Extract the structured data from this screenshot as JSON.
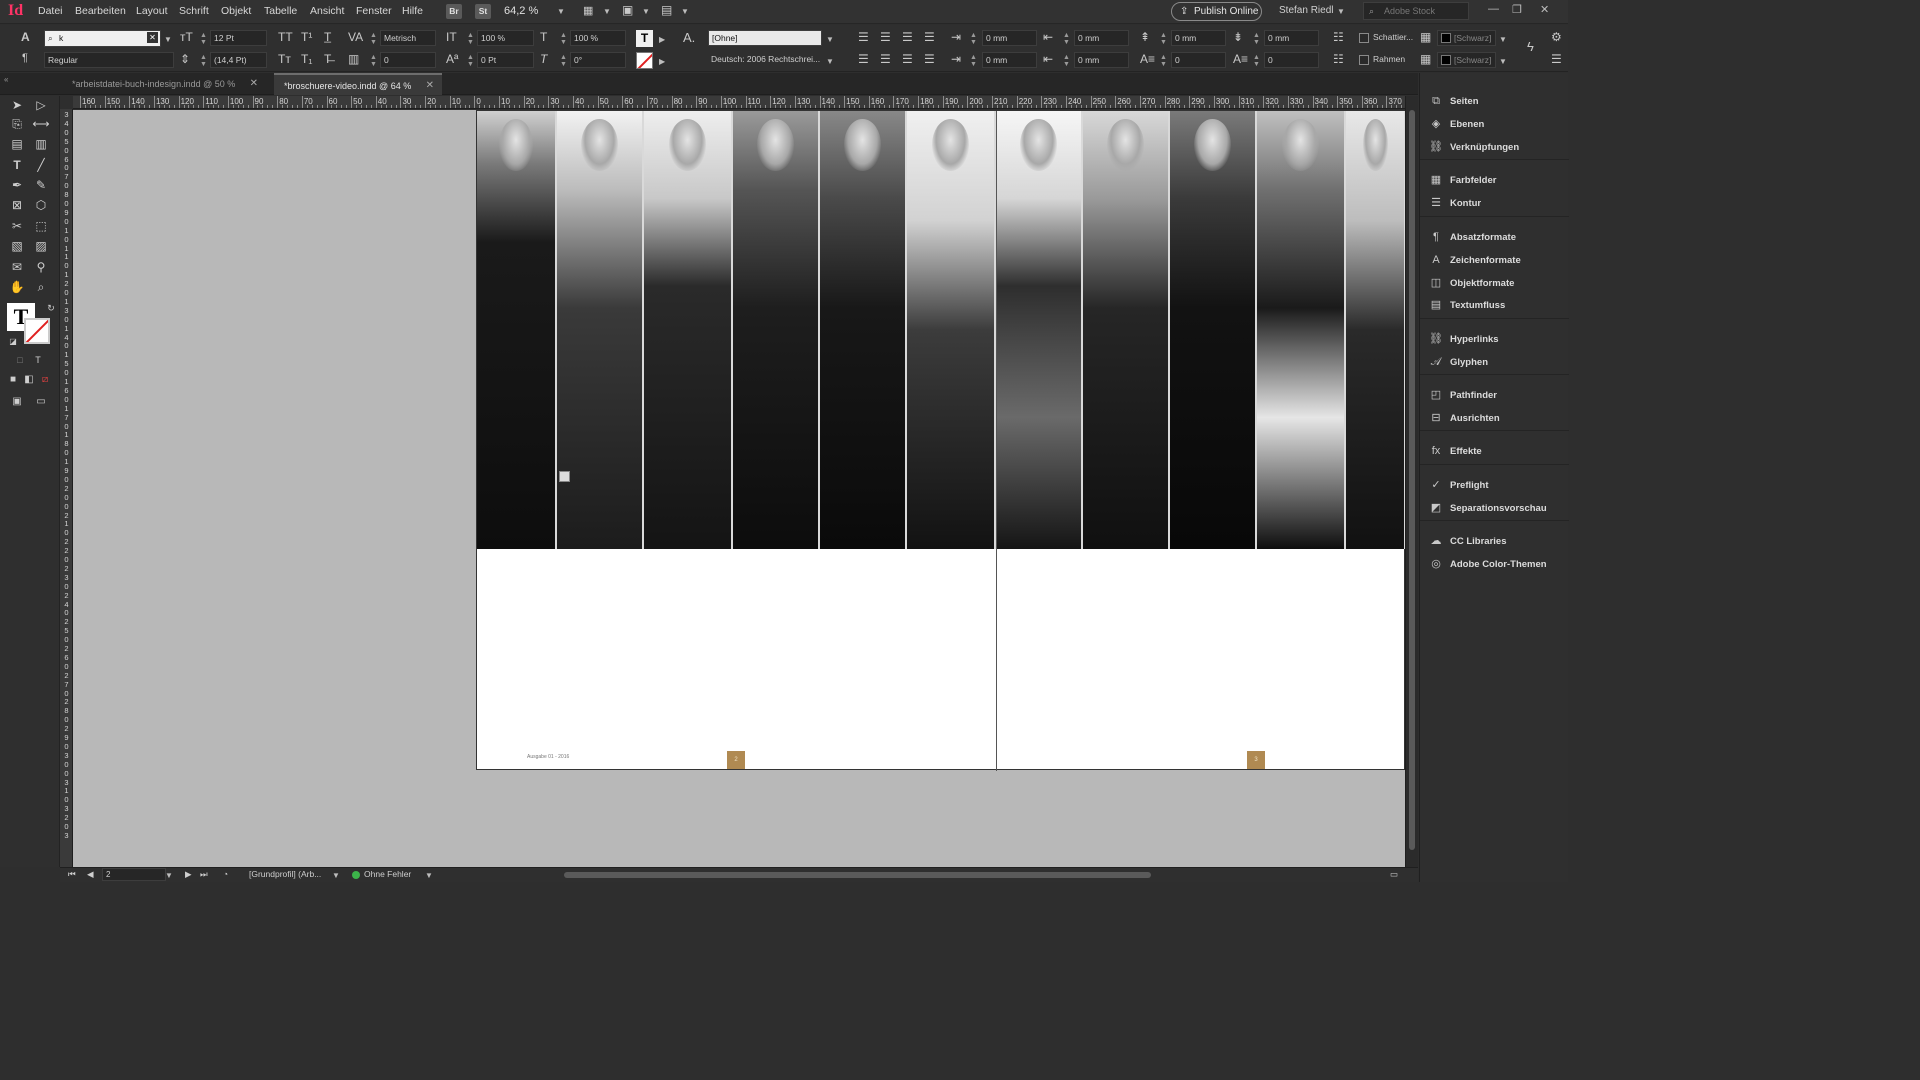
{
  "app": {
    "logo": "Id"
  },
  "menu": [
    "Datei",
    "Bearbeiten",
    "Layout",
    "Schrift",
    "Objekt",
    "Tabelle",
    "Ansicht",
    "Fenster",
    "Hilfe"
  ],
  "app_bar": {
    "bridge": "Br",
    "stock": "St",
    "zoom": "64,2 %",
    "publish": "Publish Online",
    "user": "Stefan Riedl",
    "stock_search_placeholder": "Adobe Stock"
  },
  "control": {
    "font_search_value": "k",
    "font_style": "Regular",
    "font_size": "12 Pt",
    "leading": "(14,4 Pt)",
    "kerning": "Metrisch",
    "tracking": "0",
    "vertical_scale": "100 %",
    "horizontal_scale": "100 %",
    "baseline_shift": "0 Pt",
    "skew": "0°",
    "char_style": "[Ohne]",
    "language": "Deutsch: 2006 Rechtschrei...",
    "left_indent": "0 mm",
    "first_line_indent": "0 mm",
    "right_indent": "0 mm",
    "last_line_indent": "0 mm",
    "space_before": "0 mm",
    "space_after": "0 mm",
    "drop_cap_lines": "0",
    "drop_cap_chars": "0",
    "shading_label": "Schattier...",
    "frame_label": "Rahmen",
    "shading_swatch": "[Schwarz]",
    "frame_swatch": "[Schwarz]"
  },
  "tabs": [
    {
      "label": "*arbeistdatei-buch-indesign.indd @ 50 %",
      "active": false
    },
    {
      "label": "*broschuere-video.indd @ 64 %",
      "active": true
    }
  ],
  "ruler_h": [
    "160",
    "150",
    "140",
    "130",
    "120",
    "110",
    "100",
    "90",
    "80",
    "70",
    "60",
    "50",
    "40",
    "30",
    "20",
    "10",
    "0",
    "10",
    "20",
    "30",
    "40",
    "50",
    "60",
    "70",
    "80",
    "90",
    "100",
    "110",
    "120",
    "130",
    "140",
    "150",
    "160",
    "170",
    "180",
    "190",
    "200",
    "210",
    "220",
    "230",
    "240",
    "250",
    "260",
    "270",
    "280",
    "290",
    "300",
    "310",
    "320",
    "330",
    "340",
    "350",
    "360",
    "370"
  ],
  "ruler_v": [
    "3",
    "4",
    "0",
    "5",
    "0",
    "6",
    "0",
    "7",
    "0",
    "8",
    "0",
    "9",
    "0",
    "1",
    "0",
    "1",
    "1",
    "0",
    "1",
    "2",
    "0",
    "1",
    "3",
    "0",
    "1",
    "4",
    "0",
    "1",
    "5",
    "0",
    "1",
    "6",
    "0",
    "1",
    "7",
    "0",
    "1",
    "8",
    "0",
    "1",
    "9",
    "0",
    "2",
    "0",
    "0",
    "2",
    "1",
    "0",
    "2",
    "2",
    "0",
    "2",
    "3",
    "0",
    "2",
    "4",
    "0",
    "2",
    "5",
    "0",
    "2",
    "6",
    "0",
    "2",
    "7",
    "0",
    "2",
    "8",
    "0",
    "2",
    "9",
    "0",
    "3",
    "0",
    "0",
    "3",
    "1",
    "0",
    "3",
    "2",
    "0",
    "3"
  ],
  "document": {
    "footer_text": "Ausgabe 01 - 2016",
    "page_left": "2",
    "page_right": "3"
  },
  "status": {
    "page": "2",
    "profile": "[Grundprofil] (Arb...",
    "preflight": "Ohne Fehler"
  },
  "panels": [
    {
      "label": "Seiten",
      "icon": "pages-icon"
    },
    {
      "label": "Ebenen",
      "icon": "layers-icon"
    },
    {
      "label": "Verknüpfungen",
      "icon": "links-icon"
    },
    {
      "label": "Farbfelder",
      "icon": "swatches-icon"
    },
    {
      "label": "Kontur",
      "icon": "stroke-icon"
    },
    {
      "label": "Absatzformate",
      "icon": "paragraph-styles-icon"
    },
    {
      "label": "Zeichenformate",
      "icon": "character-styles-icon"
    },
    {
      "label": "Objektformate",
      "icon": "object-styles-icon"
    },
    {
      "label": "Textumfluss",
      "icon": "text-wrap-icon"
    },
    {
      "label": "Hyperlinks",
      "icon": "hyperlinks-icon"
    },
    {
      "label": "Glyphen",
      "icon": "glyphs-icon"
    },
    {
      "label": "Pathfinder",
      "icon": "pathfinder-icon"
    },
    {
      "label": "Ausrichten",
      "icon": "align-icon"
    },
    {
      "label": "Effekte",
      "icon": "effects-icon"
    },
    {
      "label": "Preflight",
      "icon": "preflight-icon"
    },
    {
      "label": "Separationsvorschau",
      "icon": "separations-icon"
    },
    {
      "label": "CC Libraries",
      "icon": "cc-libraries-icon"
    },
    {
      "label": "Adobe Color-Themen",
      "icon": "color-themes-icon"
    }
  ],
  "colors": {
    "accent": "#ff3366",
    "preflight_ok": "#3cb34a",
    "page_number_bg": "#b08a52"
  }
}
